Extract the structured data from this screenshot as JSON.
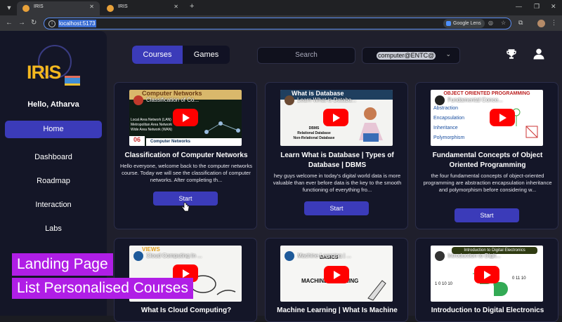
{
  "browser": {
    "tabs": [
      {
        "title": "IRIS",
        "active": true
      },
      {
        "title": "IRIS",
        "active": false
      }
    ],
    "url": "localhost:5173",
    "lens_label": "Google Lens"
  },
  "sidebar": {
    "logo_text": "IRIS",
    "greeting": "Hello, Atharva",
    "items": [
      {
        "label": "Home",
        "active": true
      },
      {
        "label": "Dashboard"
      },
      {
        "label": "Roadmap"
      },
      {
        "label": "Interaction"
      },
      {
        "label": "Labs"
      }
    ]
  },
  "topbar": {
    "toggle": {
      "courses": "Courses",
      "games": "Games"
    },
    "search_placeholder": "Search",
    "select_value": "computer@ENTC@"
  },
  "cards": [
    {
      "thumb_title": "Classification of Co...",
      "title": "Classification of Computer Networks",
      "desc": "Hello everyone, welcome back to the computer networks course. Today we will see the classification of computer networks. After completing th...",
      "start_label": "Start"
    },
    {
      "thumb_title": "Learn What is Databa...",
      "title": "Learn What is Database | Types of Database | DBMS",
      "desc": "hey guys welcome in today's digital world data is more valuable than ever before data is the key to the smooth functioning of everything fro...",
      "start_label": "Start"
    },
    {
      "thumb_title": "Fundamental Conce...",
      "title": "Fundamental Concepts of Object Oriented Programming",
      "desc": "the four fundamental concepts of object-oriented programming are abstraction encapsulation inheritance and polymorphism before considering w...",
      "start_label": "Start"
    },
    {
      "thumb_title": "Cloud Computing In ...",
      "title": "What Is Cloud Computing?"
    },
    {
      "thumb_title": "Machine Learning | ...",
      "title": "Machine Learning | What Is Machine"
    },
    {
      "thumb_title": "Introduction to Digit...",
      "title": "Introduction to Digital Electronics"
    }
  ],
  "thumb_text": {
    "c0_banner": "Computer Networks",
    "c0_lines": [
      "Local Area Network (LAN)",
      "Metropolitan Area Network",
      "Wide Area Network (WAN)"
    ],
    "c0_num": "06",
    "c0_footer": "Computer Networks",
    "c1_head": "What is Database",
    "c1_lines": [
      "DBMS",
      "Relational Database",
      "Non-Relational Database"
    ],
    "c2_head": "OBJECT ORIENTED PROGRAMMING",
    "c2_lines": [
      "Abstraction",
      "Encapsulation",
      "Inheritance",
      "Polymorphism"
    ],
    "c3_banner": "VIEWS",
    "c4_banner": "BASICS",
    "c4_mid": "MACHINE LEARNING",
    "c5_head": "Introduction to Digital Electronics",
    "c5_bits": "1 0 10 10",
    "c5_bits2": "0 11 10"
  },
  "overlays": [
    "Landing Page",
    "List Personalised Courses"
  ],
  "colors": {
    "accent": "#3b3bb9",
    "overlay": "#b01ee6",
    "logo": "#f4b81f"
  }
}
